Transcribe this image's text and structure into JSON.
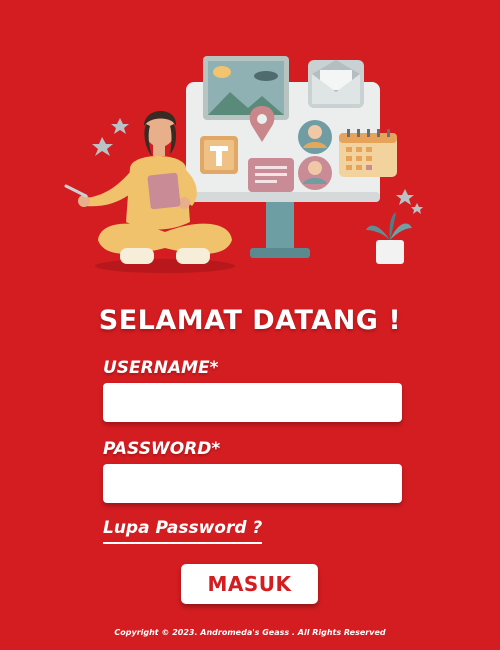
{
  "heading": "SELAMAT DATANG !",
  "form": {
    "username_label": "USERNAME*",
    "username_value": "",
    "password_label": "PASSWORD*",
    "password_value": "",
    "forgot_link": "Lupa Password ?",
    "submit_label": "MASUK"
  },
  "footer": {
    "copyright": "Copyright © 2023. Andromeda's Geass . All Rights Reserved"
  },
  "theme": {
    "background": "#d41d21",
    "button_text": "#d41d21"
  },
  "illustration": {
    "icons": [
      "picture-icon",
      "envelope-icon",
      "location-pin-icon",
      "text-icon",
      "user-avatar-icon",
      "document-icon",
      "calendar-icon",
      "plant-icon",
      "star-icon"
    ]
  }
}
